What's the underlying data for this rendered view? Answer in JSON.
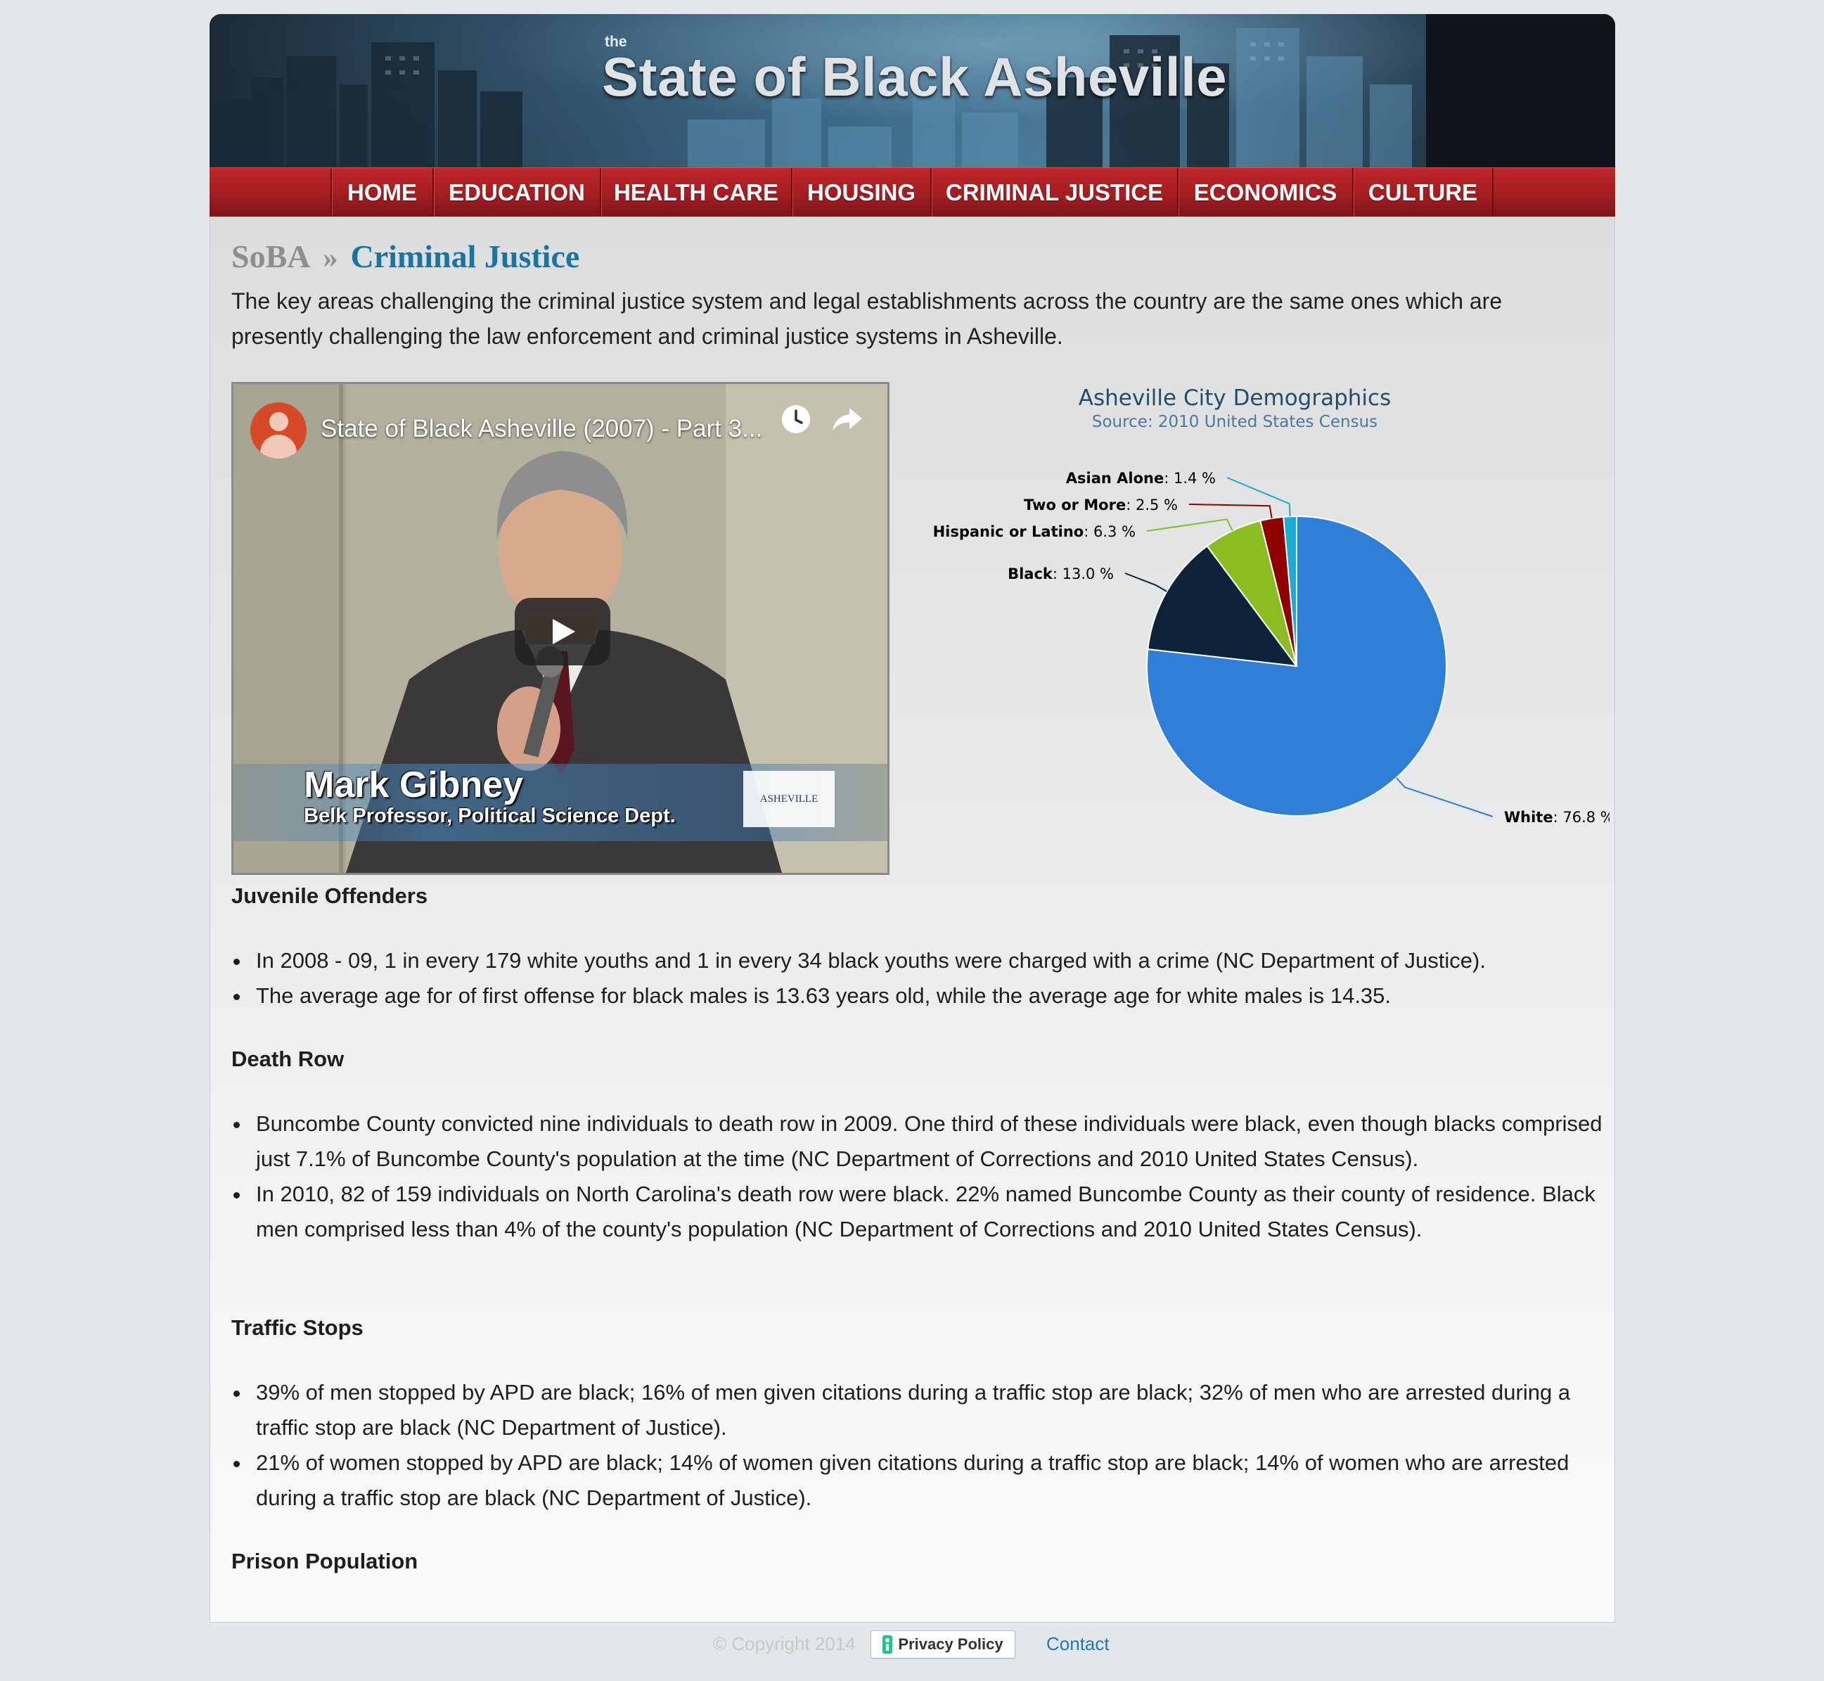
{
  "header": {
    "title_prefix": "the",
    "title": "State of Black Asheville"
  },
  "nav": {
    "items": [
      {
        "label": "HOME"
      },
      {
        "label": "EDUCATION"
      },
      {
        "label": "HEALTH CARE"
      },
      {
        "label": "HOUSING"
      },
      {
        "label": "CRIMINAL JUSTICE"
      },
      {
        "label": "ECONOMICS"
      },
      {
        "label": "CULTURE"
      }
    ]
  },
  "breadcrumb": {
    "root": "SoBA",
    "separator": "»",
    "current": "Criminal Justice"
  },
  "intro": "The key areas challenging the criminal justice system and legal establishments across the country are the same ones which are presently challenging the law enforcement and criminal justice systems in Asheville.",
  "video": {
    "title": "State of Black Asheville (2007) - Part 3...",
    "lower_third_name": "Mark Gibney",
    "lower_third_role": "Belk Professor, Political Science Dept.",
    "logo_text": "ASHEVILLE"
  },
  "chart_data": {
    "type": "pie",
    "title": "Asheville City Demographics",
    "subtitle": "Source: 2010 United States Census",
    "slices": [
      {
        "name": "White",
        "value": 76.8,
        "color": "#2f7ed8",
        "label": "White",
        "value_text": ": 76.8 %"
      },
      {
        "name": "Black",
        "value": 13.0,
        "color": "#0d233a",
        "label": "Black",
        "value_text": ": 13.0 %"
      },
      {
        "name": "Hispanic or Latino",
        "value": 6.3,
        "color": "#8bbc21",
        "label": "Hispanic or Latino",
        "value_text": ": 6.3 %"
      },
      {
        "name": "Two or More",
        "value": 2.5,
        "color": "#910000",
        "label": "Two or More",
        "value_text": ": 2.5 %"
      },
      {
        "name": "Asian Alone",
        "value": 1.4,
        "color": "#1aadce",
        "label": "Asian Alone",
        "value_text": ": 1.4 %"
      }
    ]
  },
  "sections": [
    {
      "heading": "Juvenile Offenders",
      "items": [
        "In 2008 - 09, 1 in every 179 white youths and 1 in every 34 black youths were charged with a crime (NC Department of Justice).",
        "The average age for of first offense for black males is 13.63 years old, while the average age for white males is 14.35."
      ]
    },
    {
      "heading": "Death Row",
      "items": [
        "Buncombe County convicted nine individuals to death row in 2009. One third of these individuals were black, even though blacks comprised just 7.1% of Buncombe County's population at the time (NC Department of Corrections and 2010 United States Census).",
        "In 2010, 82 of 159 individuals on North Carolina's death row were black. 22% named Buncombe County as their county of residence. Black men comprised less than 4% of the county's population (NC Department of Corrections and 2010 United States Census)."
      ]
    },
    {
      "heading": "Traffic Stops",
      "items": [
        "39% of men stopped by APD are black; 16% of men given citations during a traffic stop are black; 32% of men who are arrested during a traffic stop are black (NC Department of Justice).",
        "21% of women stopped by APD are black; 14% of women given citations during a traffic stop are black; 14% of women who are arrested during a traffic stop are black (NC Department of Justice)."
      ]
    },
    {
      "heading": "Prison Population",
      "items": []
    }
  ],
  "footer": {
    "copyright": "© Copyright 2014",
    "privacy_label": "Privacy Policy",
    "contact_label": "Contact"
  }
}
